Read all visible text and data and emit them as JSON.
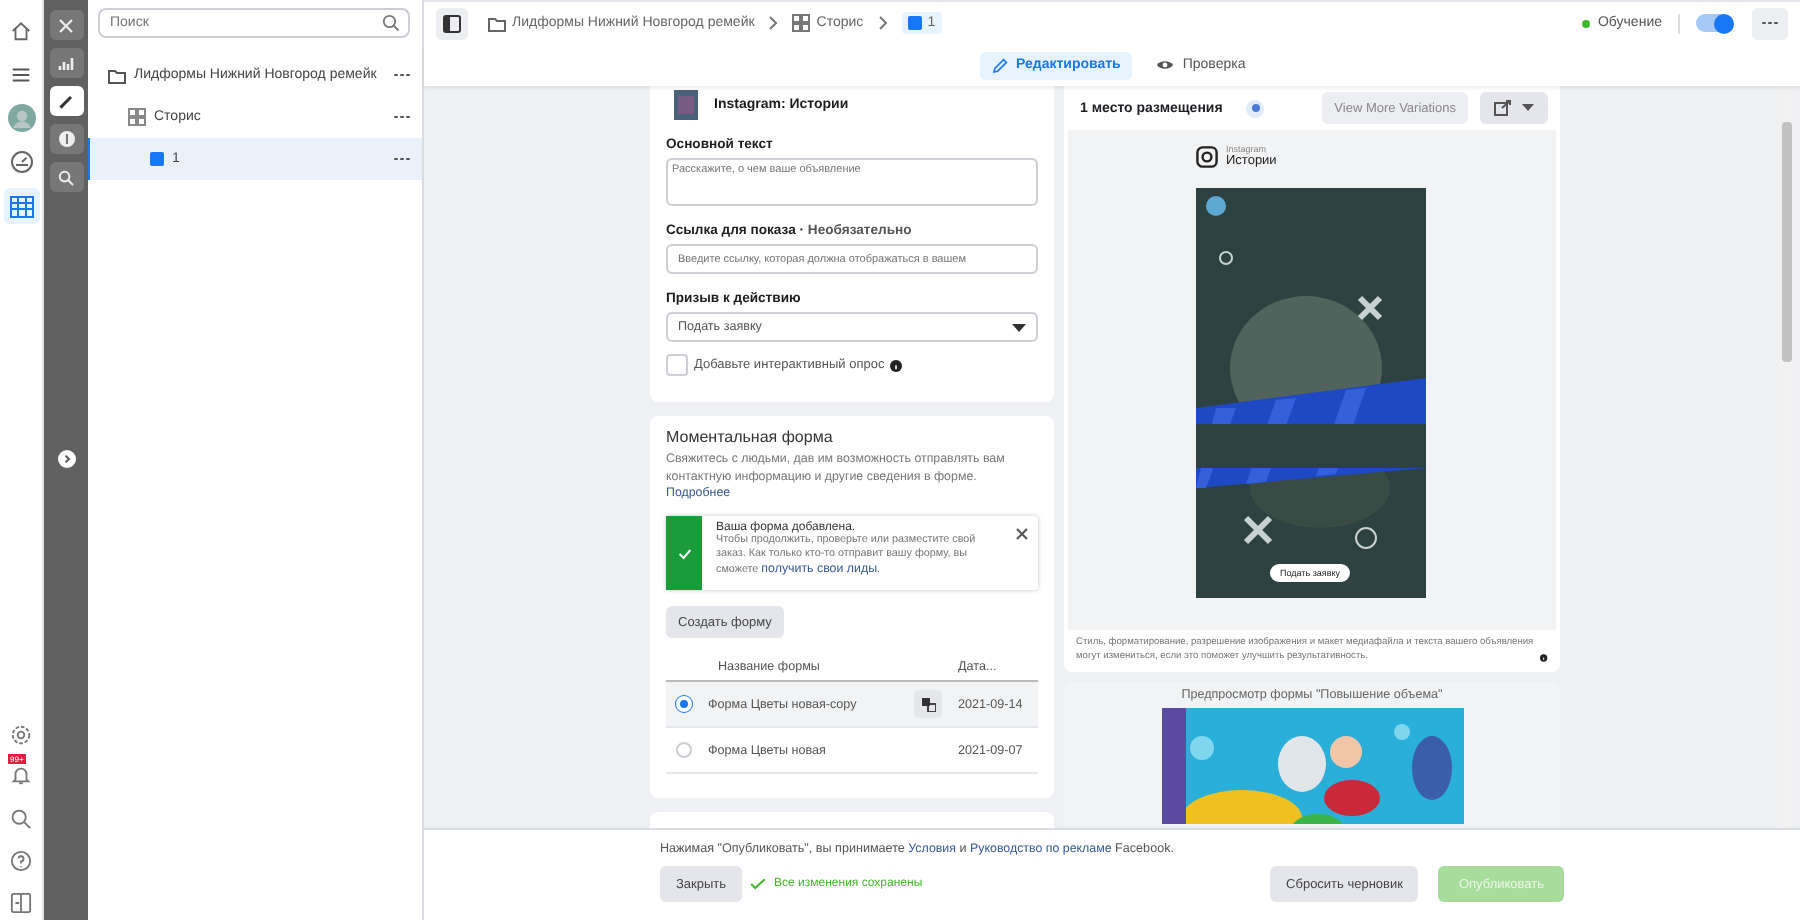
{
  "icon_rail": {
    "top": [
      {
        "kind": "home",
        "selected": false
      },
      {
        "kind": "menu",
        "selected": false
      },
      {
        "kind": "avatar",
        "selected": false
      },
      {
        "kind": "gauge",
        "selected": false
      },
      {
        "kind": "grid",
        "selected": true
      }
    ],
    "bottom": [
      {
        "kind": "settings"
      },
      {
        "kind": "bell",
        "badge": "99+"
      },
      {
        "kind": "search"
      },
      {
        "kind": "help"
      },
      {
        "kind": "panel"
      }
    ]
  },
  "tool_rail": {
    "items": [
      {
        "kind": "close",
        "selected": false
      },
      {
        "kind": "chart",
        "selected": false
      },
      {
        "kind": "pencil",
        "selected": true
      },
      {
        "kind": "dollar",
        "selected": false
      },
      {
        "kind": "zoom",
        "selected": false
      }
    ]
  },
  "tree": {
    "search": {
      "placeholder": "Поиск"
    },
    "items": [
      {
        "kind": "campaign",
        "label": "Лидформы Нижний Новгород ремейк",
        "selected": false,
        "children": [
          {
            "kind": "adset",
            "label": "Сторис",
            "selected": false,
            "children": [
              {
                "kind": "ad",
                "label": "1",
                "selected": true
              }
            ]
          }
        ]
      }
    ]
  },
  "breadcrumb": [
    {
      "kind": "campaign",
      "label": "Лидформы Нижний Новгород ремейк"
    },
    {
      "kind": "adset",
      "label": "Сторис"
    },
    {
      "kind": "ad",
      "label": "1"
    }
  ],
  "status": {
    "label": "Обучение",
    "on": true
  },
  "tabs": [
    {
      "kind": "edit",
      "label": "Редактировать",
      "selected": true
    },
    {
      "kind": "review",
      "label": "Проверка",
      "selected": false
    }
  ],
  "editor": {
    "placement": "Instagram: Истории",
    "primary_text": {
      "label": "Основной текст",
      "placeholder": "Расскажите, о чем ваше объявление"
    },
    "display_link": {
      "label": "Ссылка для показа",
      "separator": "·",
      "optional": "Необязательно",
      "placeholder": "Введите ссылку, которая должна отображаться в вашем"
    },
    "cta": {
      "label": "Призыв к действию",
      "value": "Подать заявку"
    },
    "poll": {
      "label": "Добавьте интерактивный опрос",
      "checked": false
    }
  },
  "instant_form": {
    "title": "Моментальная форма",
    "description": "Свяжитесь с людьми, дав им возможность отправлять вам контактную информацию и другие сведения в форме.",
    "link": "Подробнее",
    "notice": {
      "title": "Ваша форма добавлена.",
      "text": "Чтобы продолжить, проверьте или разместите свой заказ. Как только кто-то отправит вашу форму, вы сможете ",
      "link": "получить свои лиды",
      "end": "."
    },
    "create_button": "Создать форму",
    "columns": [
      "Название формы",
      "Дата..."
    ],
    "rows": [
      {
        "name": "Форма Цветы новая-copy",
        "date": "2021-09-14",
        "selected": true,
        "copy": true
      },
      {
        "name": "Форма Цветы новая",
        "date": "2021-09-07",
        "selected": false,
        "copy": false
      }
    ]
  },
  "preview": {
    "title": "1 место размещения",
    "variations_button": "View More Variations",
    "platform": "Instagram",
    "placement": "Истории",
    "cta": "Подать заявку",
    "disclaimer": "Стиль, форматирование, разрешение изображения и макет медиафайла и текста вашего объявления могут измениться, если это поможет улучшить результативность.",
    "form_preview_title": "Предпросмотр формы \"Повышение объема\""
  },
  "footer": {
    "terms": {
      "before": "Нажимая \"Опубликовать\", вы принимаете ",
      "link1": "Условия",
      "mid": " и ",
      "link2": "Руководство по рекламе",
      "after": " Facebook."
    },
    "close_button": "Закрыть",
    "saved": "Все изменения сохранены",
    "discard_button": "Сбросить черновик",
    "publish_button": {
      "label": "Опубликовать",
      "disabled": true
    }
  }
}
